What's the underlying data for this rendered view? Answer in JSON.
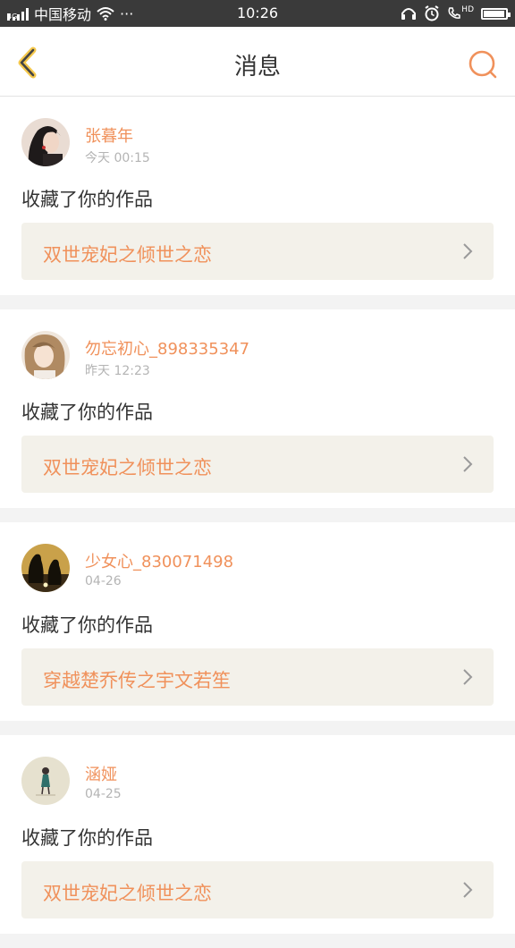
{
  "status_bar": {
    "network_type": "4G",
    "carrier": "中国移动",
    "more": "···",
    "time": "10:26",
    "hd_label": "HD",
    "battery_level": 0.95
  },
  "header": {
    "title": "消息",
    "back_icon": "chevron-left-icon",
    "search_icon": "search-icon",
    "accent_color": "#f0915b"
  },
  "messages": [
    {
      "username": "张暮年",
      "time": "今天 00:15",
      "action": "收藏了你的作品",
      "work_title": "双世宠妃之倾世之恋"
    },
    {
      "username": "勿忘初心_898335347",
      "time": "昨天 12:23",
      "action": "收藏了你的作品",
      "work_title": "双世宠妃之倾世之恋"
    },
    {
      "username": "少女心_830071498",
      "time": "04-26",
      "action": "收藏了你的作品",
      "work_title": "穿越楚乔传之宇文若笙"
    },
    {
      "username": "涵娅",
      "time": "04-25",
      "action": "收藏了你的作品",
      "work_title": "双世宠妃之倾世之恋"
    }
  ]
}
